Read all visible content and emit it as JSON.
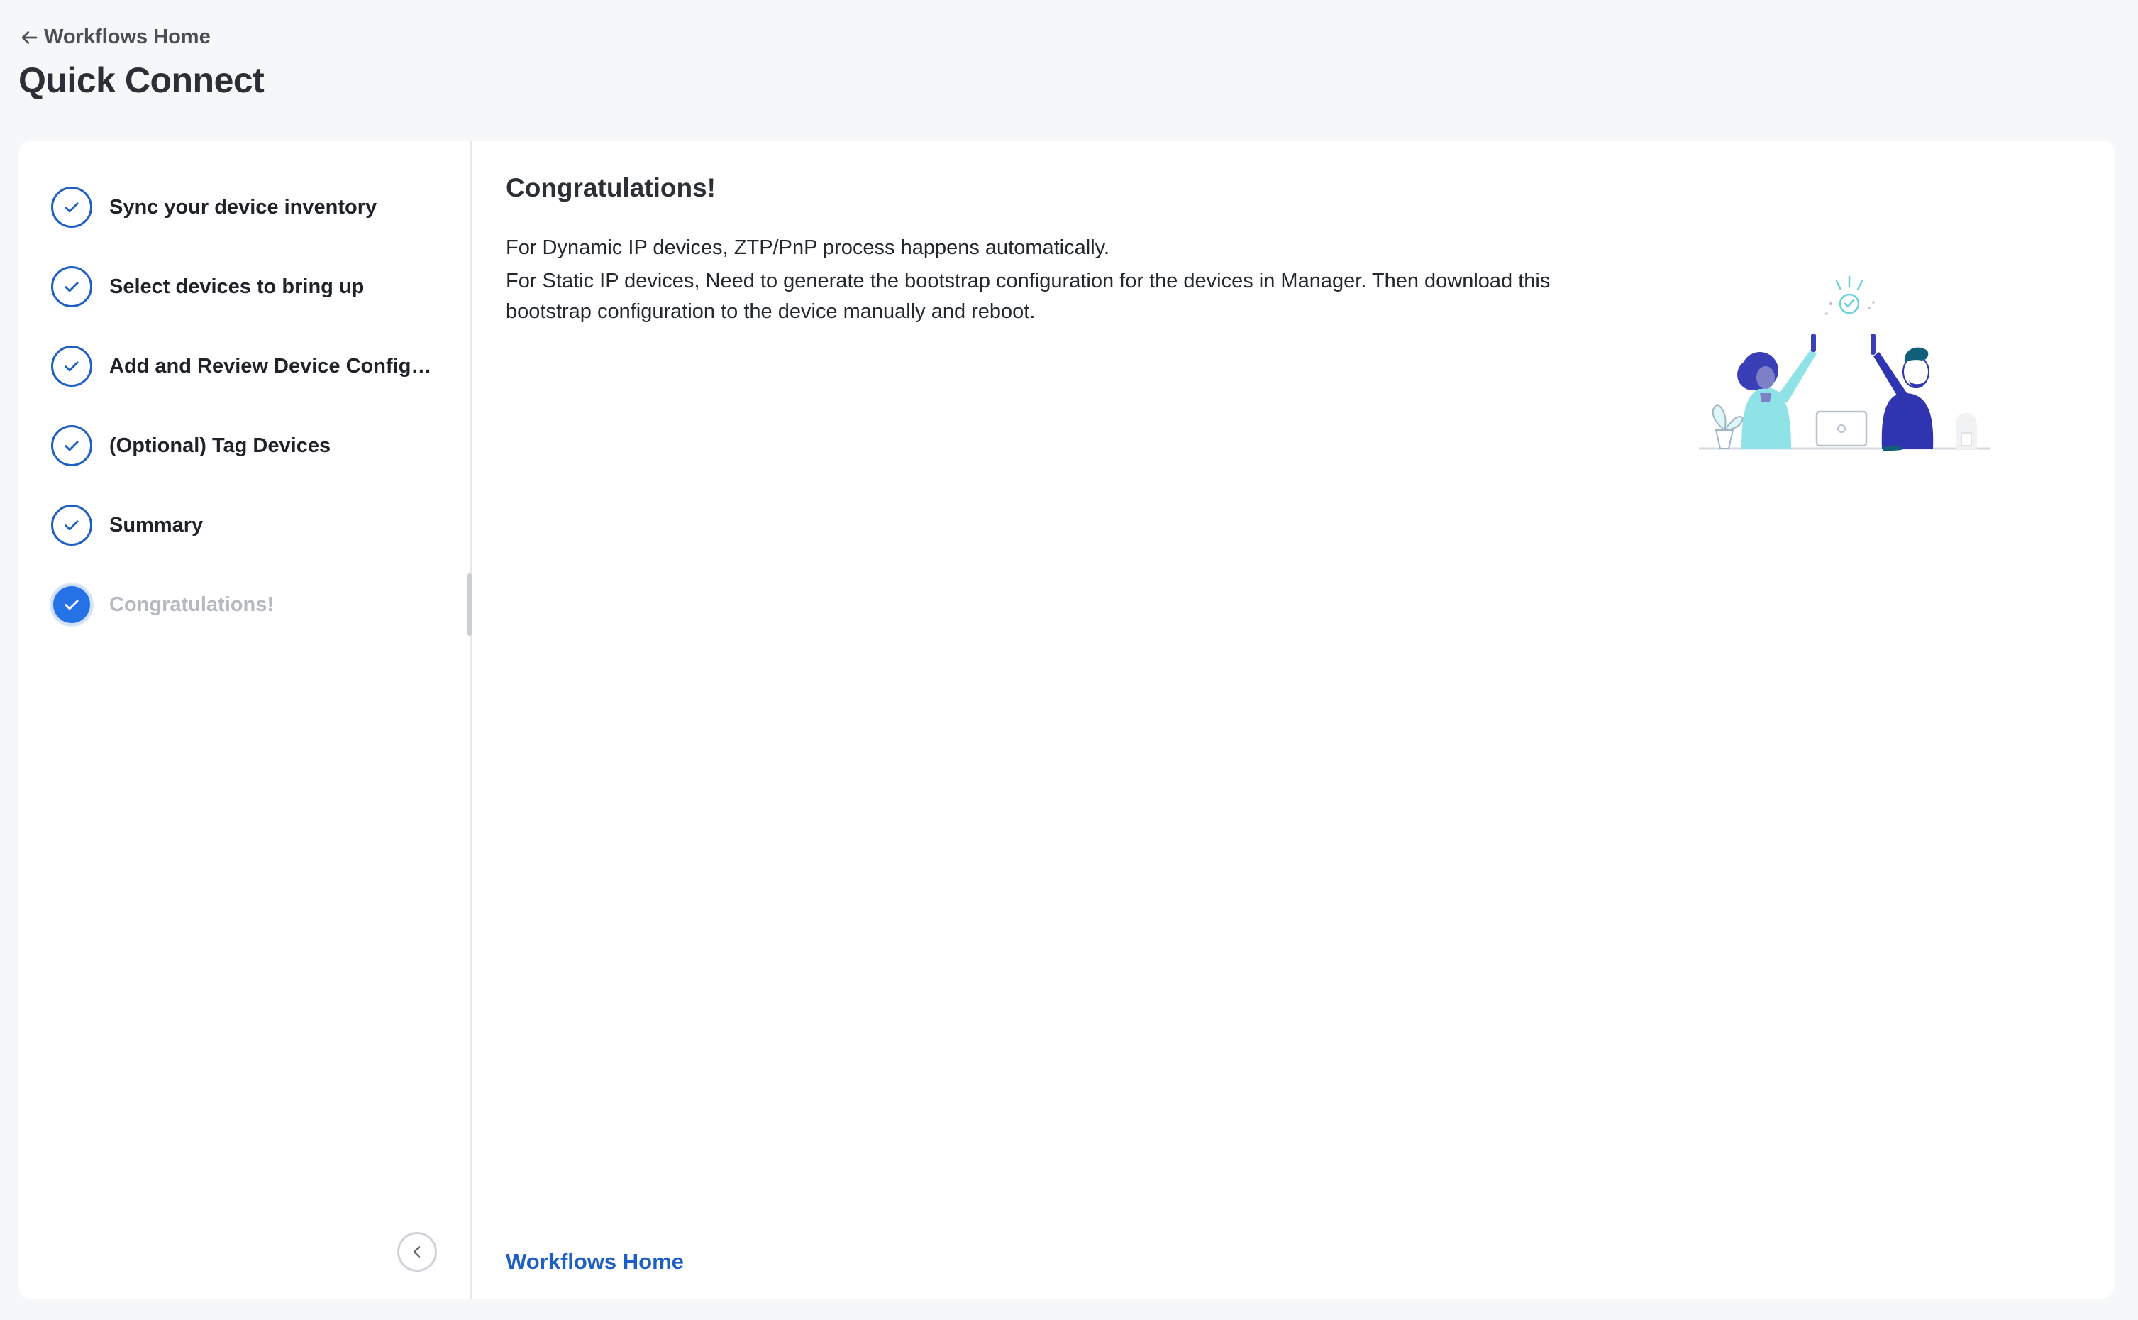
{
  "header": {
    "back_label": "Workflows Home",
    "title": "Quick Connect"
  },
  "steps": [
    {
      "label": "Sync your device inventory",
      "status": "complete"
    },
    {
      "label": "Select devices to bring up",
      "status": "complete"
    },
    {
      "label": "Add and Review Device Configur...",
      "status": "complete"
    },
    {
      "label": "(Optional) Tag Devices",
      "status": "complete"
    },
    {
      "label": "Summary",
      "status": "complete"
    },
    {
      "label": "Congratulations!",
      "status": "current"
    }
  ],
  "main": {
    "title": "Congratulations!",
    "paragraph_1": "For Dynamic IP devices, ZTP/PnP process happens automatically.",
    "paragraph_2": "For Static IP devices, Need to generate the bootstrap configuration for the devices in Manager. Then download this bootstrap configuration to the device manually and reboot.",
    "footer_link": "Workflows Home"
  },
  "colors": {
    "accent": "#1d5fc2",
    "active_step": "#2472e6",
    "background": "#f6f7f8",
    "illustration_teal": "#8fe3e6",
    "illustration_indigo": "#3a3fb8"
  },
  "icons": {
    "back": "arrow-left-icon",
    "step_complete": "check-icon",
    "collapse": "chevron-left-icon"
  }
}
